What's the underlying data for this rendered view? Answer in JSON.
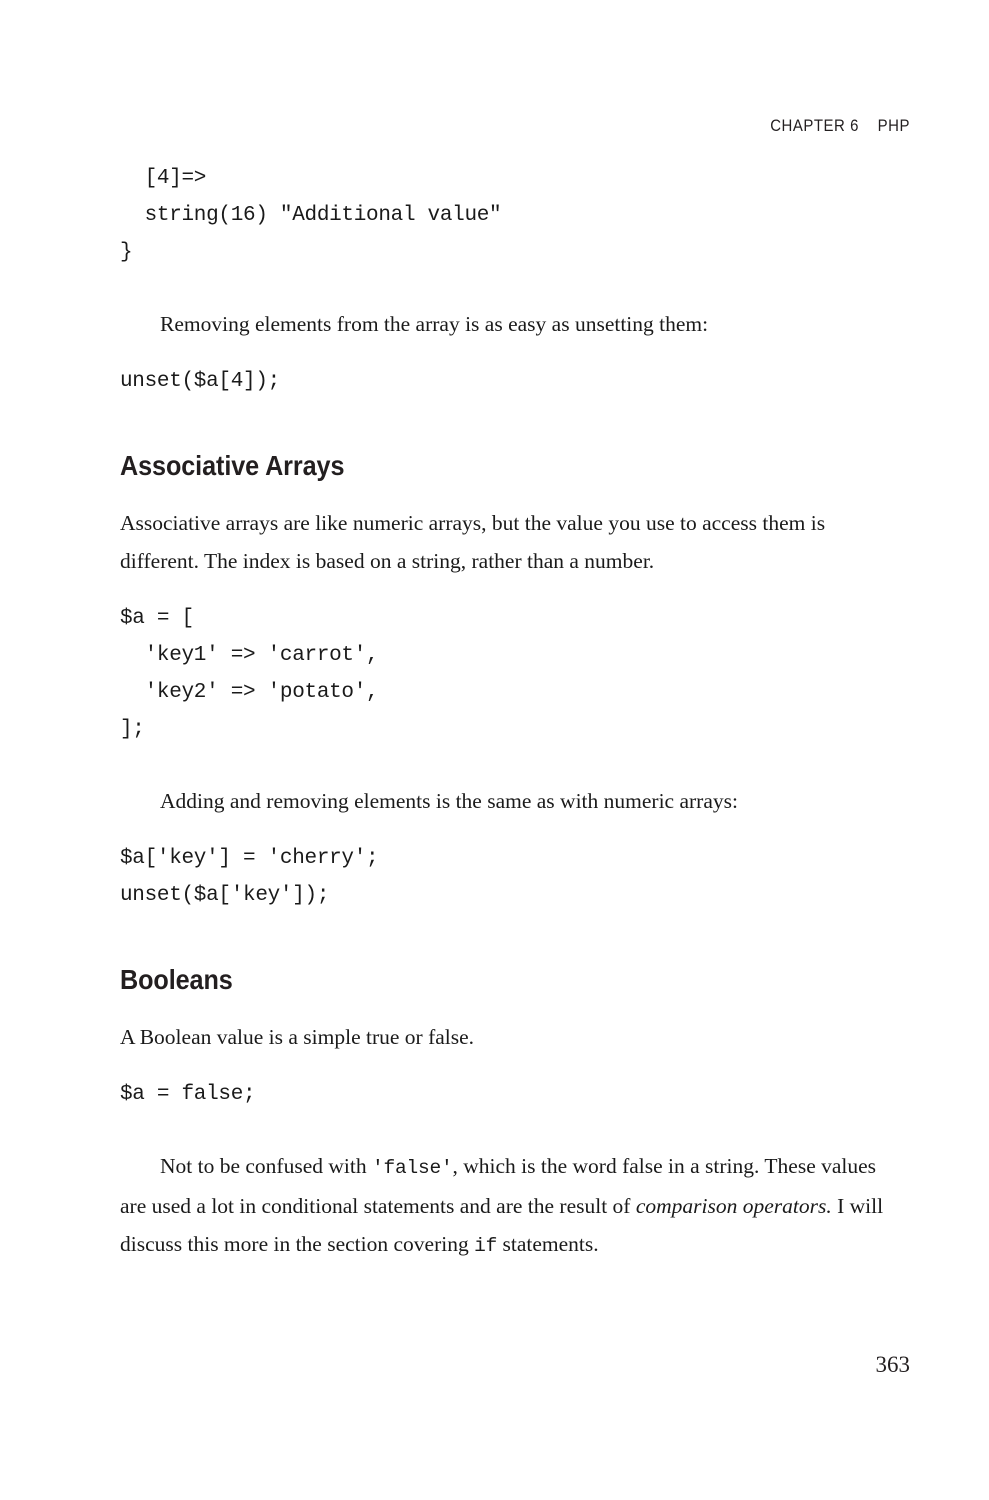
{
  "running_head": {
    "chapter_label": "CHAPTER 6",
    "section_label": "PHP",
    "combined": "CHAPTER 6    PHP"
  },
  "blocks": {
    "code_dump_tail": "  [4]=>\n  string(16) \"Additional value\"\n}",
    "para_removing": "Removing elements from the array is as easy as unsetting them:",
    "code_unset_numeric": "unset($a[4]);",
    "heading_associative": "Associative Arrays",
    "para_associative_intro": "Associative arrays are like numeric arrays, but the value you use to access them is different. The index is based on a string, rather than a number.",
    "code_assoc_literal": "$a = [\n  'key1' => 'carrot',\n  'key2' => 'potato',\n];",
    "para_adding_removing": "Adding and removing elements is the same as with numeric arrays:",
    "code_assoc_set_unset": "$a['key'] = 'cherry';\nunset($a['key']);",
    "heading_booleans": "Booleans",
    "para_boolean_intro": "A Boolean value is a simple true or false.",
    "code_bool_assign": "$a = false;",
    "para_confused": {
      "t1": "Not to be confused with ",
      "c1": "'false'",
      "t2": ", which is the word false in a string. These values are used a lot in conditional statements and are the result of ",
      "i1": "comparison operators.",
      "t3": " I will discuss this more in the section covering ",
      "c2": "if",
      "t4": " statements."
    }
  },
  "folio": "363",
  "colors": {
    "text": "#1a1a1a",
    "heading": "#231f20",
    "background": "#ffffff"
  }
}
